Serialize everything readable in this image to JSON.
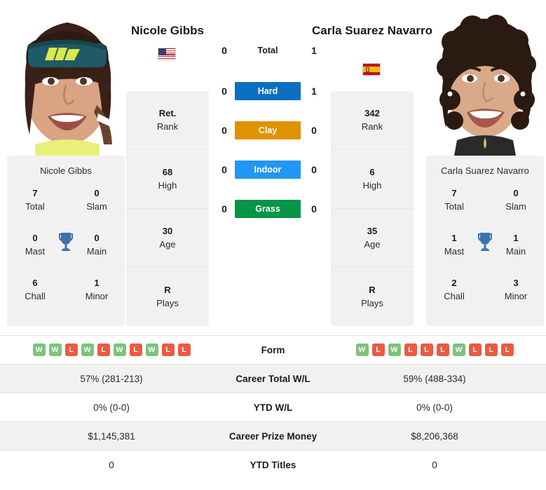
{
  "players": {
    "left": {
      "name": "Nicole Gibbs",
      "country": "USA",
      "flag_icon": "flag-usa-icon",
      "card_name": "Nicole Gibbs",
      "titles": {
        "total": "7",
        "total_label": "Total",
        "slam": "0",
        "slam_label": "Slam",
        "mast": "0",
        "mast_label": "Mast",
        "main": "0",
        "main_label": "Main",
        "chall": "6",
        "chall_label": "Chall",
        "minor": "1",
        "minor_label": "Minor"
      },
      "profile": [
        {
          "value": "Ret.",
          "label": "Rank"
        },
        {
          "value": "68",
          "label": "High"
        },
        {
          "value": "30",
          "label": "Age"
        },
        {
          "value": "R",
          "label": "Plays"
        }
      ],
      "form": [
        "W",
        "W",
        "L",
        "W",
        "L",
        "W",
        "L",
        "W",
        "L",
        "L"
      ],
      "career_total_wl": "57% (281-213)",
      "ytd_wl": "0% (0-0)",
      "career_prize_money": "$1,145,381",
      "ytd_titles": "0"
    },
    "right": {
      "name": "Carla Suarez Navarro",
      "country": "ESP",
      "flag_icon": "flag-spain-icon",
      "card_name": "Carla Suarez Navarro",
      "titles": {
        "total": "7",
        "total_label": "Total",
        "slam": "0",
        "slam_label": "Slam",
        "mast": "1",
        "mast_label": "Mast",
        "main": "1",
        "main_label": "Main",
        "chall": "2",
        "chall_label": "Chall",
        "minor": "3",
        "minor_label": "Minor"
      },
      "profile": [
        {
          "value": "342",
          "label": "Rank"
        },
        {
          "value": "6",
          "label": "High"
        },
        {
          "value": "35",
          "label": "Age"
        },
        {
          "value": "R",
          "label": "Plays"
        }
      ],
      "form": [
        "W",
        "L",
        "W",
        "L",
        "L",
        "L",
        "W",
        "L",
        "L",
        "L"
      ],
      "career_total_wl": "59% (488-334)",
      "ytd_wl": "0% (0-0)",
      "career_prize_money": "$8,206,368",
      "ytd_titles": "0"
    }
  },
  "head_to_head": [
    {
      "label": "Total",
      "left": "0",
      "right": "1",
      "color": "",
      "badge": false
    },
    {
      "label": "Hard",
      "left": "0",
      "right": "1",
      "color": "#0d6fbf",
      "badge": true
    },
    {
      "label": "Clay",
      "left": "0",
      "right": "0",
      "color": "#e09200",
      "badge": true
    },
    {
      "label": "Indoor",
      "left": "0",
      "right": "0",
      "color": "#2196f3",
      "badge": true
    },
    {
      "label": "Grass",
      "left": "0",
      "right": "0",
      "color": "#069447",
      "badge": true
    }
  ],
  "stats_rows": [
    {
      "label": "Form",
      "type": "form"
    },
    {
      "label": "Career Total W/L",
      "type": "text",
      "key": "career_total_wl"
    },
    {
      "label": "YTD W/L",
      "type": "text",
      "key": "ytd_wl"
    },
    {
      "label": "Career Prize Money",
      "type": "text",
      "key": "career_prize_money"
    },
    {
      "label": "YTD Titles",
      "type": "text",
      "key": "ytd_titles"
    }
  ],
  "icons": {
    "trophy": "trophy-icon",
    "trophy_color": "#3b72ad"
  }
}
